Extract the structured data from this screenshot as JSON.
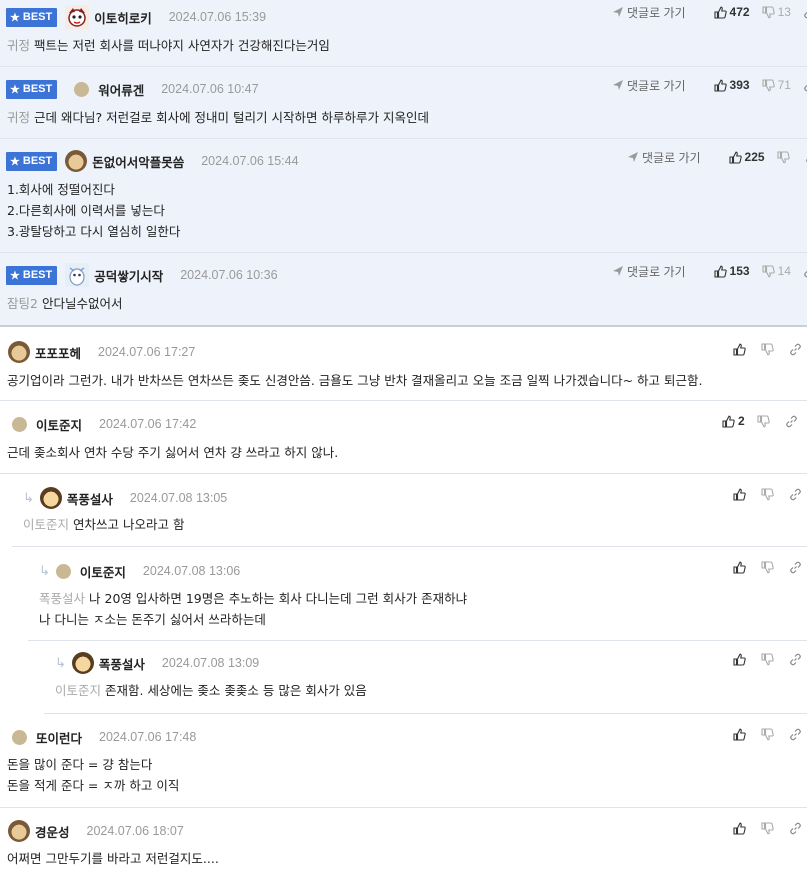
{
  "labels": {
    "best": "BEST",
    "reply": "댓글로 가기"
  },
  "best_comments": [
    {
      "nick": "이토히로키",
      "date": "2024.07.06 15:39",
      "tag": "귀정",
      "lines": [
        "팩트는 저런 회사를 떠나야지 사연자가 건강해진다는거임"
      ],
      "up": "472",
      "down": "13"
    },
    {
      "nick": "워어류겐",
      "date": "2024.07.06 10:47",
      "tag": "귀정",
      "lines": [
        "근데 왜다님? 저런걸로 회사에 정내미 털리기 시작하면 하루하루가 지옥인데"
      ],
      "up": "393",
      "down": "71"
    },
    {
      "nick": "돈없어서악플못씀",
      "date": "2024.07.06 15:44",
      "tag": "",
      "lines": [
        "1.회사에 정떨어진다",
        "2.다른회사에 이력서를 넣는다",
        "3.광탈당하고 다시 열심히 일한다"
      ],
      "up": "225",
      "down": ""
    },
    {
      "nick": "공덕쌓기시작",
      "date": "2024.07.06 10:36",
      "tag": "잠팅2",
      "lines": [
        "안다닐수없어서"
      ],
      "up": "153",
      "down": "14"
    }
  ],
  "comments": [
    {
      "nick": "포포포헤",
      "date": "2024.07.06 17:27",
      "tag": "",
      "lines": [
        "공기업이라 그런가. 내가 반차쓰든 연차쓰든 좆도 신경안씀. 금욜도 그냥 반차 결재올리고 오늘 조금 일찍 나가겠습니다~ 하고 퇴근함."
      ],
      "up": ""
    },
    {
      "nick": "이토준지",
      "date": "2024.07.06 17:42",
      "tag": "",
      "lines": [
        "근데 좆소회사 연차 수당 주기 싫어서 연차 걍 쓰라고 하지 않나."
      ],
      "up": "2"
    },
    {
      "nick": "폭풍설사",
      "date": "2024.07.08 13:05",
      "tag": "이토준지",
      "lines": [
        "연차쓰고 나오라고 함"
      ],
      "up": ""
    },
    {
      "nick": "이토준지",
      "date": "2024.07.08 13:06",
      "tag": "폭풍설사",
      "lines": [
        "나 20영 입사하면 19명은 추노하는 회사 다니는데 그런 회사가 존재하냐",
        "나 다니는 ㅈ소는 돈주기 싫어서 쓰라하는데"
      ],
      "up": ""
    },
    {
      "nick": "폭풍설사",
      "date": "2024.07.08 13:09",
      "tag": "이토준지",
      "lines": [
        "존재함. 세상에는 좆소 좆좆소 등 많은 회사가 있음"
      ],
      "up": ""
    },
    {
      "nick": "또이런다",
      "date": "2024.07.06 17:48",
      "tag": "",
      "lines": [
        "돈을 많이 준다 = 걍 참는다",
        "돈을 적게 준다 = ㅈ까 하고 이직"
      ],
      "up": ""
    },
    {
      "nick": "경운성",
      "date": "2024.07.06 18:07",
      "tag": "",
      "lines": [
        "어쩌면 그만두기를 바라고 저런걸지도...."
      ],
      "up": ""
    }
  ],
  "colors": {
    "best_bg": "#eef3fb",
    "badge": "#3b73d6",
    "border": "#dfe3ea"
  }
}
